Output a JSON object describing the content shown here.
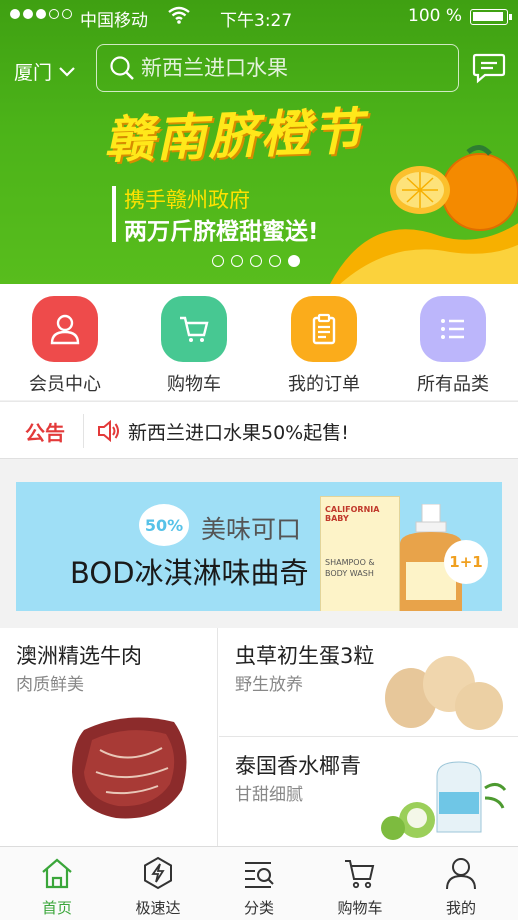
{
  "status_bar": {
    "carrier": "中国移动",
    "time": "下午3:27",
    "battery": "100 %"
  },
  "header": {
    "city": "厦门",
    "search_placeholder": "新西兰进口水果"
  },
  "banner": {
    "title": "赣南脐橙节",
    "line1": "携手赣州政府",
    "line2": "两万斤脐橙甜蜜送!",
    "slide_count": 5,
    "active_slide": 5
  },
  "quick_menu": [
    {
      "label": "会员中心",
      "color": "#ee4b4b",
      "icon": "user-icon"
    },
    {
      "label": "购物车",
      "color": "#47c892",
      "icon": "cart-icon"
    },
    {
      "label": "我的订单",
      "color": "#fbac1b",
      "icon": "clipboard-icon"
    },
    {
      "label": "所有品类",
      "color": "#bcb6fb",
      "icon": "list-icon"
    }
  ],
  "notice": {
    "tag": "公告",
    "text": "新西兰进口水果50%起售!"
  },
  "ad": {
    "badge": "50%",
    "subtitle": "美味可口",
    "title": "BOD冰淇淋味曲奇",
    "brand": "CALIFORNIA BABY",
    "product_text": "SHAMPOO & BODY WASH",
    "deal": "1+1"
  },
  "products": [
    {
      "title": "澳洲精选牛肉",
      "subtitle": "肉质鲜美"
    },
    {
      "title": "虫草初生蛋3粒",
      "subtitle": "野生放养"
    },
    {
      "title": "泰国香水椰青",
      "subtitle": "甘甜细腻"
    }
  ],
  "tabs": [
    {
      "label": "首页",
      "icon": "home-icon",
      "active": true
    },
    {
      "label": "极速达",
      "icon": "lightning-icon",
      "active": false
    },
    {
      "label": "分类",
      "icon": "category-search-icon",
      "active": false
    },
    {
      "label": "购物车",
      "icon": "cart-icon",
      "active": false
    },
    {
      "label": "我的",
      "icon": "person-icon",
      "active": false
    }
  ],
  "colors": {
    "brand_green": "#4cb319",
    "notice_red": "#e33a3a",
    "tab_active": "#3aa63a"
  }
}
